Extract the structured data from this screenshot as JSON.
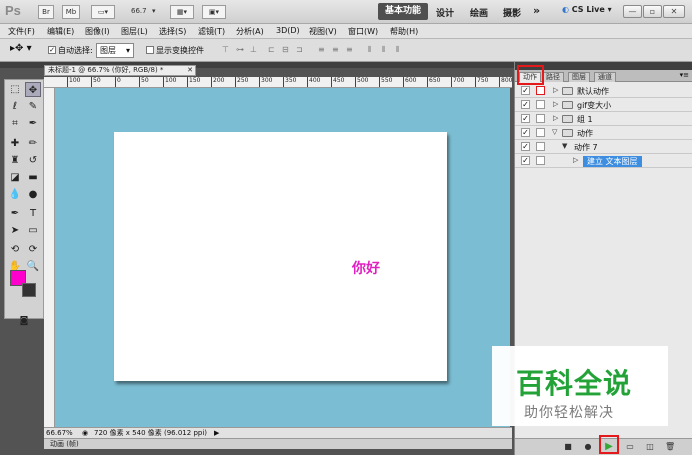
{
  "appbar": {
    "logo": "Ps",
    "zoom": "66.7",
    "workspace_selected": "基本功能",
    "workspaces": [
      "设计",
      "绘画",
      "摄影"
    ],
    "more": "»",
    "cs_live": "CS Live"
  },
  "menu": [
    "文件(F)",
    "编辑(E)",
    "图像(I)",
    "图层(L)",
    "选择(S)",
    "滤镜(T)",
    "分析(A)",
    "3D(D)",
    "视图(V)",
    "窗口(W)",
    "帮助(H)"
  ],
  "options": {
    "auto_select_label": "自动选择:",
    "auto_select_value": "图层",
    "show_transform_label": "显示变换控件"
  },
  "document": {
    "tab_title": "未标题-1 @ 66.7% (你好, RGB/8) *",
    "ruler_ticks": [
      "100",
      "50",
      "0",
      "50",
      "100",
      "150",
      "200",
      "250",
      "300",
      "350",
      "400",
      "450",
      "500",
      "550",
      "600",
      "650",
      "700",
      "750",
      "800"
    ],
    "canvas_text": "你好",
    "canvas_text_color": "#e020c0",
    "zoom_status": "66.67%",
    "doc_info": "720 像素 x 540 像素 (96.012 ppi)",
    "anim_label": "动画 (帧)"
  },
  "panel": {
    "tabs": [
      "动作",
      "路径",
      "图层",
      "通道"
    ],
    "active_tab": "动作",
    "actions": [
      {
        "label": "默认动作",
        "type": "folder",
        "expanded": false
      },
      {
        "label": "gif变大小",
        "type": "folder",
        "expanded": false
      },
      {
        "label": "组 1",
        "type": "folder",
        "expanded": false
      },
      {
        "label": "动作",
        "type": "folder",
        "expanded": true
      },
      {
        "label": "动作 7",
        "type": "action",
        "expanded": true
      },
      {
        "label": "建立 文本图层",
        "type": "step",
        "selected": true
      }
    ]
  },
  "watermark": {
    "logo": "百科全说",
    "sub": "助你轻松解决"
  }
}
